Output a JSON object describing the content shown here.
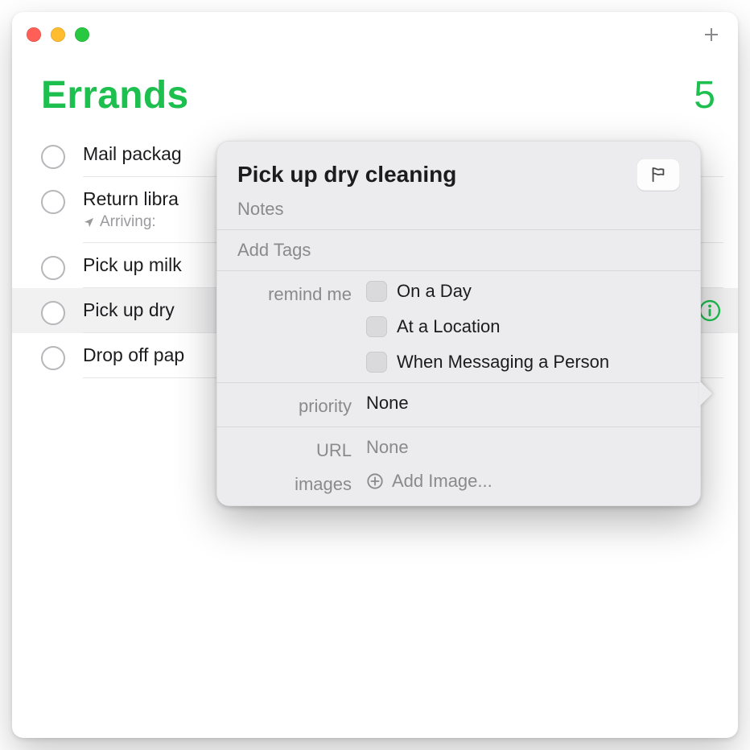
{
  "header": {
    "title": "Errands",
    "count": "5"
  },
  "rows": [
    {
      "title": "Mail packag"
    },
    {
      "title": "Return libra",
      "sub_prefix": "Arriving: "
    },
    {
      "title": "Pick up milk"
    },
    {
      "title": "Pick up dry "
    },
    {
      "title": "Drop off pap"
    }
  ],
  "popover": {
    "title": "Pick up dry cleaning",
    "notes_placeholder": "Notes",
    "tags_placeholder": "Add Tags",
    "remind_label": "remind me",
    "opt_day": "On a Day",
    "opt_location": "At a Location",
    "opt_message": "When Messaging a Person",
    "priority_label": "priority",
    "priority_value": "None",
    "url_label": "URL",
    "url_value": "None",
    "images_label": "images",
    "add_image_label": "Add Image..."
  }
}
